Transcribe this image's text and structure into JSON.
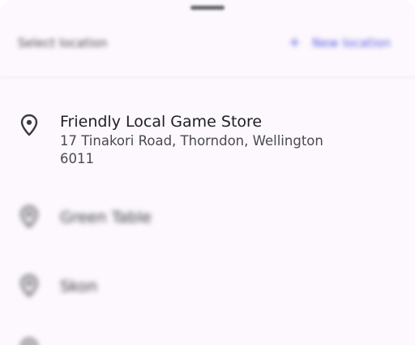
{
  "header": {
    "title": "Select location",
    "new_location_label": "New location",
    "new_location_icon": "plus-icon"
  },
  "locations": [
    {
      "name": "Friendly Local Game Store",
      "address": "17 Tinakori Road, Thorndon, Wellington 6011",
      "icon": "location-pin-icon"
    },
    {
      "name": "Green Table",
      "icon": "location-pin-icon"
    },
    {
      "name": "Skon",
      "icon": "location-pin-icon"
    },
    {
      "name": "",
      "icon": "location-pin-icon"
    }
  ],
  "colors": {
    "accent": "#5a5de0",
    "sheet_background": "#fcf8fd",
    "primary_text": "#202024",
    "secondary_text": "#4a4a4e"
  }
}
